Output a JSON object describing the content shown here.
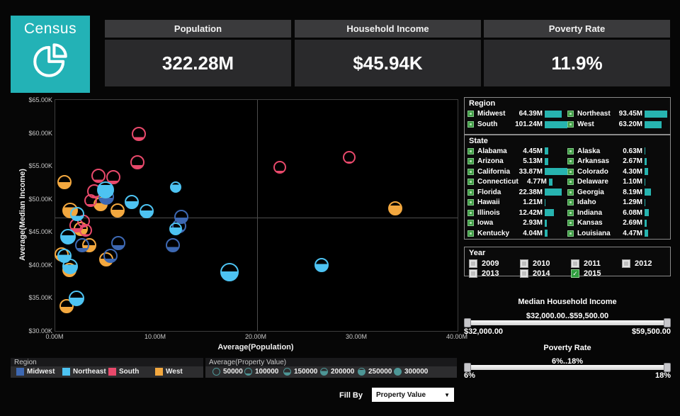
{
  "header": {
    "logo": {
      "title": "Census",
      "bg": "#23b2b6"
    },
    "kpis": [
      {
        "label": "Population",
        "value": "322.28M"
      },
      {
        "label": "Household Income",
        "value": "$45.94K"
      },
      {
        "label": "Poverty Rate",
        "value": "11.9%"
      }
    ]
  },
  "chart_data": {
    "type": "scatter",
    "xlabel": "Average(Population)",
    "ylabel": "Average(Median Income)",
    "x_ticks": [
      "0.00M",
      "10.00M",
      "20.00M",
      "30.00M",
      "40.00M"
    ],
    "y_ticks": [
      "$65.00K",
      "$60.00K",
      "$55.00K",
      "$50.00K",
      "$45.00K",
      "$40.00K",
      "$35.00K",
      "$30.00K"
    ],
    "xlim": [
      0,
      40
    ],
    "ylim": [
      30,
      65
    ],
    "x_unit": "millions of people",
    "y_unit": "thousands of dollars",
    "grid": false,
    "ref_line_x": 20.1,
    "ref_line_y": 47.2,
    "point_format": "[x_population_M, y_median_income_K, fill_fraction_property_value, radius_px]",
    "series": [
      {
        "name": "Midwest",
        "color": "#3d68b2",
        "points": [
          [
            5.1,
            50.3,
            0.45,
            11
          ],
          [
            12.5,
            47.3,
            0.45,
            10
          ],
          [
            12.3,
            45.9,
            0.2,
            10
          ],
          [
            6.3,
            43.3,
            0.3,
            10
          ],
          [
            2.7,
            43.0,
            0.25,
            10
          ],
          [
            5.5,
            41.4,
            0.25,
            10
          ],
          [
            11.7,
            43.0,
            0.35,
            10
          ]
        ]
      },
      {
        "name": "Northeast",
        "color": "#4dc3f2",
        "points": [
          [
            5.0,
            51.4,
            0.85,
            12
          ],
          [
            7.6,
            49.5,
            0.55,
            10
          ],
          [
            12.0,
            51.8,
            0.8,
            8
          ],
          [
            9.1,
            48.1,
            0.55,
            10
          ],
          [
            2.2,
            47.7,
            0.35,
            10
          ],
          [
            1.3,
            44.3,
            0.6,
            11
          ],
          [
            12.0,
            45.5,
            0.65,
            9
          ],
          [
            0.9,
            41.4,
            0.6,
            10
          ],
          [
            1.5,
            39.8,
            0.65,
            11
          ],
          [
            17.3,
            38.9,
            0.55,
            13
          ],
          [
            2.1,
            34.9,
            0.55,
            11
          ],
          [
            26.5,
            40.0,
            0.6,
            10
          ]
        ]
      },
      {
        "name": "South",
        "color": "#e8496b",
        "points": [
          [
            8.3,
            59.8,
            0.22,
            10
          ],
          [
            8.2,
            55.6,
            0.25,
            10
          ],
          [
            4.3,
            53.5,
            0.15,
            10
          ],
          [
            5.8,
            53.3,
            0.2,
            10
          ],
          [
            3.9,
            51.2,
            0.1,
            10
          ],
          [
            3.5,
            49.8,
            0.15,
            9
          ],
          [
            2.1,
            46.0,
            0.25,
            10
          ],
          [
            2.8,
            46.6,
            0.12,
            9
          ],
          [
            3.0,
            45.2,
            0.12,
            9
          ],
          [
            22.3,
            54.8,
            0.15,
            9
          ],
          [
            29.2,
            56.3,
            0.08,
            9
          ]
        ]
      },
      {
        "name": "West",
        "color": "#f3a83f",
        "points": [
          [
            0.9,
            52.5,
            0.5,
            10
          ],
          [
            4.5,
            49.2,
            0.6,
            10
          ],
          [
            6.2,
            48.2,
            0.55,
            10
          ],
          [
            1.5,
            48.2,
            0.75,
            11
          ],
          [
            2.5,
            45.5,
            0.5,
            10
          ],
          [
            3.4,
            43.0,
            0.5,
            10
          ],
          [
            0.6,
            41.6,
            0.4,
            10
          ],
          [
            5.1,
            40.8,
            0.55,
            10
          ],
          [
            1.4,
            39.2,
            0.5,
            10
          ],
          [
            1.1,
            33.8,
            0.45,
            10
          ],
          [
            33.8,
            48.6,
            0.75,
            10
          ]
        ]
      }
    ]
  },
  "legends": {
    "region": {
      "title": "Region",
      "items": [
        {
          "label": "Midwest",
          "color": "#3d68b2"
        },
        {
          "label": "Northeast",
          "color": "#4dc3f2"
        },
        {
          "label": "South",
          "color": "#e8496b"
        },
        {
          "label": "West",
          "color": "#f3a83f"
        }
      ]
    },
    "size": {
      "title": "Average(Property Value)",
      "color": "#4d9696",
      "items": [
        {
          "label": "50000",
          "fill": 0
        },
        {
          "label": "100000",
          "fill": 0.2
        },
        {
          "label": "150000",
          "fill": 0.4
        },
        {
          "label": "200000",
          "fill": 0.6
        },
        {
          "label": "250000",
          "fill": 0.8
        },
        {
          "label": "300000",
          "fill": 1
        }
      ]
    }
  },
  "fill_by": {
    "label": "Fill By",
    "value": "Property Value"
  },
  "panels": {
    "region": {
      "title": "Region",
      "bar_color": "#27b4b0",
      "items": [
        {
          "label": "Midwest",
          "value": "64.39M",
          "v": 64.39
        },
        {
          "label": "Northeast",
          "value": "93.45M",
          "v": 93.45
        },
        {
          "label": "South",
          "value": "101.24M",
          "v": 101.24
        },
        {
          "label": "West",
          "value": "63.20M",
          "v": 63.2
        }
      ]
    },
    "state": {
      "title": "State",
      "items": [
        {
          "label": "Alabama",
          "value": "4.45M",
          "v": 4.45
        },
        {
          "label": "Alaska",
          "value": "0.63M",
          "v": 0.63
        },
        {
          "label": "Arizona",
          "value": "5.13M",
          "v": 5.13
        },
        {
          "label": "Arkansas",
          "value": "2.67M",
          "v": 2.67
        },
        {
          "label": "California",
          "value": "33.87M",
          "v": 33.87
        },
        {
          "label": "Colorado",
          "value": "4.30M",
          "v": 4.3
        },
        {
          "label": "Connecticut",
          "value": "4.77M",
          "v": 4.77
        },
        {
          "label": "Delaware",
          "value": "1.10M",
          "v": 1.1
        },
        {
          "label": "Florida",
          "value": "22.38M",
          "v": 22.38
        },
        {
          "label": "Georgia",
          "value": "8.19M",
          "v": 8.19
        },
        {
          "label": "Hawaii",
          "value": "1.21M",
          "v": 1.21
        },
        {
          "label": "Idaho",
          "value": "1.29M",
          "v": 1.29
        },
        {
          "label": "Illinois",
          "value": "12.42M",
          "v": 12.42
        },
        {
          "label": "Indiana",
          "value": "6.08M",
          "v": 6.08
        },
        {
          "label": "Iowa",
          "value": "2.93M",
          "v": 2.93
        },
        {
          "label": "Kansas",
          "value": "2.69M",
          "v": 2.69
        },
        {
          "label": "Kentucky",
          "value": "4.04M",
          "v": 4.04
        },
        {
          "label": "Louisiana",
          "value": "4.47M",
          "v": 4.47
        }
      ]
    },
    "year": {
      "title": "Year",
      "items": [
        {
          "label": "2009",
          "checked": false
        },
        {
          "label": "2010",
          "checked": false
        },
        {
          "label": "2011",
          "checked": false
        },
        {
          "label": "2012",
          "checked": false
        },
        {
          "label": "2013",
          "checked": false
        },
        {
          "label": "2014",
          "checked": false
        },
        {
          "label": "2015",
          "checked": true
        }
      ]
    },
    "income_slider": {
      "title": "Median Household Income",
      "range": "$32,000.00..$59,500.00",
      "min": "$32,000.00",
      "max": "$59,500.00"
    },
    "poverty_slider": {
      "title": "Poverty Rate",
      "range": "6%..18%",
      "min": "6%",
      "max": "18%"
    }
  }
}
